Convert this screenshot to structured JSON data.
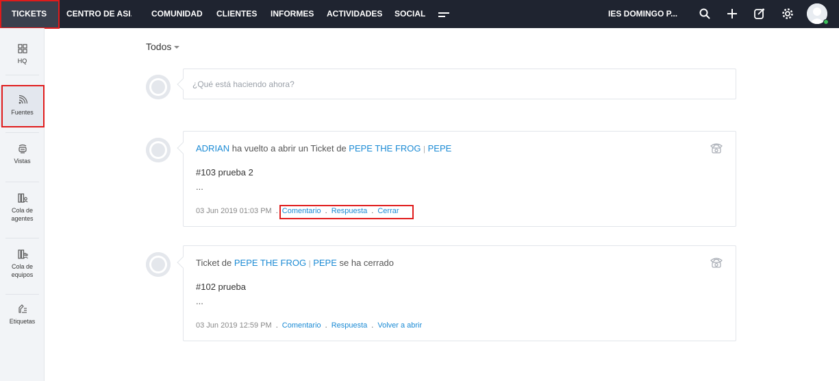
{
  "topnav": {
    "items": [
      "TICKETS",
      "CENTRO DE ASI...",
      "COMUNIDAD",
      "CLIENTES",
      "INFORMES",
      "ACTIVIDADES",
      "SOCIAL"
    ],
    "org_name": "IES DOMINGO P...",
    "icons": [
      "search-icon",
      "plus-icon",
      "compose-icon",
      "gear-icon"
    ]
  },
  "sidebar": {
    "items": [
      {
        "label": "HQ",
        "icon": "grid-icon"
      },
      {
        "label": "Fuentes",
        "icon": "feed-icon"
      },
      {
        "label": "Vistas",
        "icon": "views-icon"
      },
      {
        "label": "Cola de agentes",
        "icon": "agent-queue-icon"
      },
      {
        "label": "Cola de equipos",
        "icon": "team-queue-icon"
      },
      {
        "label": "Etiquetas",
        "icon": "tag-icon"
      }
    ]
  },
  "feed": {
    "filter": "Todos",
    "compose_placeholder": "¿Qué está haciendo ahora?",
    "posts": [
      {
        "actor": "ADRIAN",
        "action": " ha vuelto a abrir un Ticket de ",
        "contact": "PEPE THE FROG",
        "separator": "|",
        "account": "PEPE",
        "title": "#103 prueba 2",
        "ellipsis": "...",
        "timestamp": "03 Jun 2019 01:03 PM",
        "actions": [
          "Comentario",
          "Respuesta",
          "Cerrar"
        ]
      },
      {
        "prefix": "Ticket de ",
        "contact": "PEPE THE FROG",
        "separator": "|",
        "account": "PEPE",
        "suffix": " se ha cerrado",
        "title": "#102 prueba",
        "ellipsis": "...",
        "timestamp": "03 Jun 2019 12:59 PM",
        "actions": [
          "Comentario",
          "Respuesta",
          "Volver a abrir"
        ]
      }
    ]
  },
  "colors": {
    "topbar": "#1f2430",
    "link": "#1a8ad4",
    "highlight": "#e01b1b",
    "online": "#3cbf5a"
  }
}
